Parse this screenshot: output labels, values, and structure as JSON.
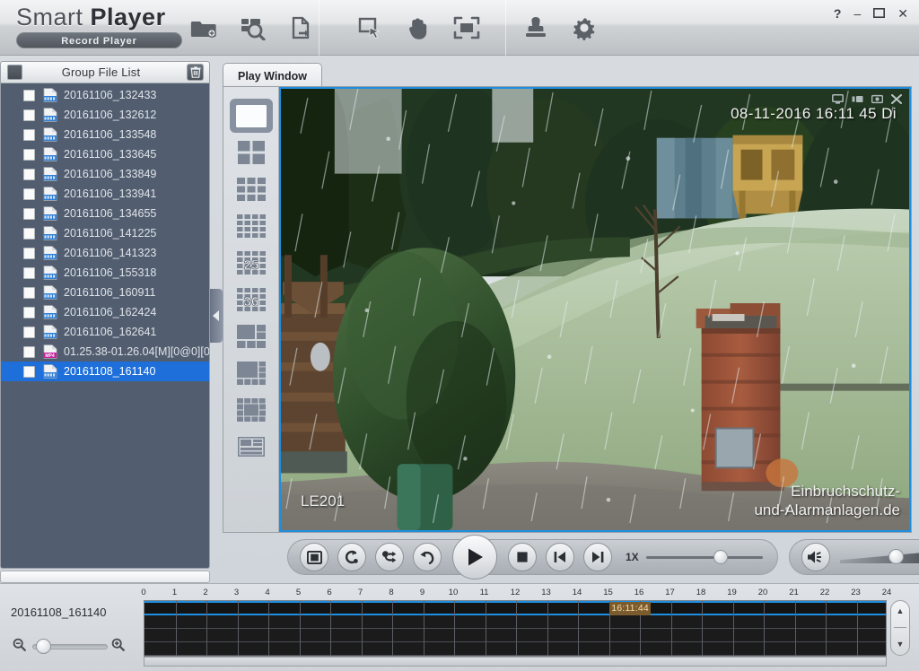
{
  "app": {
    "brand_light": "Smart ",
    "brand_bold": "Player",
    "subtitle": "Record Player"
  },
  "titlebar": {
    "tools": [
      {
        "name": "open-folder-button",
        "icon": "folder-add-icon"
      },
      {
        "name": "search-files-button",
        "icon": "grid-search-icon"
      },
      {
        "name": "export-file-button",
        "icon": "file-export-icon"
      },
      {
        "name": "select-area-button",
        "icon": "cursor-select-icon"
      },
      {
        "name": "pan-hand-button",
        "icon": "hand-icon"
      },
      {
        "name": "fullscreen-button",
        "icon": "expand-icon"
      },
      {
        "name": "watermark-button",
        "icon": "stamp-icon"
      },
      {
        "name": "settings-button",
        "icon": "gear-icon"
      }
    ],
    "window_controls": [
      {
        "name": "help-button",
        "glyph": "?"
      },
      {
        "name": "minimize-button",
        "glyph": "–"
      },
      {
        "name": "maximize-button",
        "glyph": "❐"
      },
      {
        "name": "close-button",
        "glyph": "✕"
      }
    ]
  },
  "sidebar": {
    "title": "Group File List",
    "select_all_label": "",
    "delete_label": "",
    "files": [
      {
        "name": "20161106_132433",
        "type": "dav",
        "checked": false,
        "selected": false
      },
      {
        "name": "20161106_132612",
        "type": "dav",
        "checked": false,
        "selected": false
      },
      {
        "name": "20161106_133548",
        "type": "dav",
        "checked": false,
        "selected": false
      },
      {
        "name": "20161106_133645",
        "type": "dav",
        "checked": false,
        "selected": false
      },
      {
        "name": "20161106_133849",
        "type": "dav",
        "checked": false,
        "selected": false
      },
      {
        "name": "20161106_133941",
        "type": "dav",
        "checked": false,
        "selected": false
      },
      {
        "name": "20161106_134655",
        "type": "dav",
        "checked": false,
        "selected": false
      },
      {
        "name": "20161106_141225",
        "type": "dav",
        "checked": false,
        "selected": false
      },
      {
        "name": "20161106_141323",
        "type": "dav",
        "checked": false,
        "selected": false
      },
      {
        "name": "20161106_155318",
        "type": "dav",
        "checked": false,
        "selected": false
      },
      {
        "name": "20161106_160911",
        "type": "dav",
        "checked": false,
        "selected": false
      },
      {
        "name": "20161106_162424",
        "type": "dav",
        "checked": false,
        "selected": false
      },
      {
        "name": "20161106_162641",
        "type": "dav",
        "checked": false,
        "selected": false
      },
      {
        "name": "01.25.38-01.26.04[M][0@0][0",
        "type": "mp4",
        "checked": false,
        "selected": false
      },
      {
        "name": "20161108_161140",
        "type": "dav",
        "checked": false,
        "selected": true
      }
    ]
  },
  "tabs": [
    {
      "label": "Play Window",
      "active": true
    }
  ],
  "layouts": [
    {
      "name": "layout-1",
      "kind": "single",
      "active": true
    },
    {
      "name": "layout-4",
      "kind": "grid2",
      "active": false
    },
    {
      "name": "layout-9",
      "kind": "grid3",
      "active": false
    },
    {
      "name": "layout-16",
      "kind": "grid4",
      "active": false
    },
    {
      "name": "layout-25",
      "kind": "num",
      "label": "25",
      "active": false
    },
    {
      "name": "layout-36",
      "kind": "num",
      "label": "36",
      "active": false
    },
    {
      "name": "layout-6",
      "kind": "mix6",
      "active": false
    },
    {
      "name": "layout-8",
      "kind": "mix8",
      "active": false
    },
    {
      "name": "layout-13",
      "kind": "mix13",
      "active": false
    },
    {
      "name": "layout-custom",
      "kind": "custom",
      "active": false
    }
  ],
  "video": {
    "osd_timestamp": "08-11-2016 16:11 45 Di",
    "camera_label": "LE201",
    "watermark_line1": "Einbruchschutz-",
    "watermark_line2": "und-Alarmanlagen.de",
    "overlay_controls": [
      {
        "name": "video-snapshot-icon",
        "glyph": "▣"
      },
      {
        "name": "video-record-icon",
        "glyph": "▮"
      },
      {
        "name": "video-camera-icon",
        "glyph": "■"
      },
      {
        "name": "video-close-icon",
        "glyph": "✕"
      }
    ]
  },
  "controls": {
    "buttons": [
      {
        "name": "stop-all-button",
        "icon": "frame-icon"
      },
      {
        "name": "loop-play-button",
        "icon": "loop-icon"
      },
      {
        "name": "shuffle-play-button",
        "icon": "shuffle-icon"
      },
      {
        "name": "replay-button",
        "icon": "undo-arrow-icon"
      },
      {
        "name": "play-button",
        "icon": "play-icon"
      },
      {
        "name": "stop-button",
        "icon": "stop-square-icon"
      },
      {
        "name": "prev-frame-button",
        "icon": "step-back-icon"
      },
      {
        "name": "next-frame-button",
        "icon": "step-forward-icon"
      }
    ],
    "speed_label": "1X",
    "speed_value": 58,
    "volume_icon": "speaker-icon",
    "volume_value": 52,
    "settings_icon": "sliders-icon"
  },
  "timeline": {
    "file_label": "20161108_161140",
    "hour_ticks": [
      "0",
      "1",
      "2",
      "3",
      "4",
      "5",
      "6",
      "7",
      "8",
      "9",
      "10",
      "11",
      "12",
      "13",
      "14",
      "15",
      "16",
      "17",
      "18",
      "19",
      "20",
      "21",
      "22",
      "23",
      "24"
    ],
    "cursor_time": "16:11:44",
    "cursor_hour": 15.05,
    "rows": 4,
    "zoom_out_icon": "zoom-out-icon",
    "zoom_in_icon": "zoom-in-icon",
    "scroll_up_glyph": "▲",
    "scroll_down_glyph": "▼"
  },
  "colors": {
    "accent": "#1e8fe0",
    "selection": "#1e6fd9",
    "sidebar_bg": "#525e70",
    "cursor_badge": "#7a5c2e"
  }
}
